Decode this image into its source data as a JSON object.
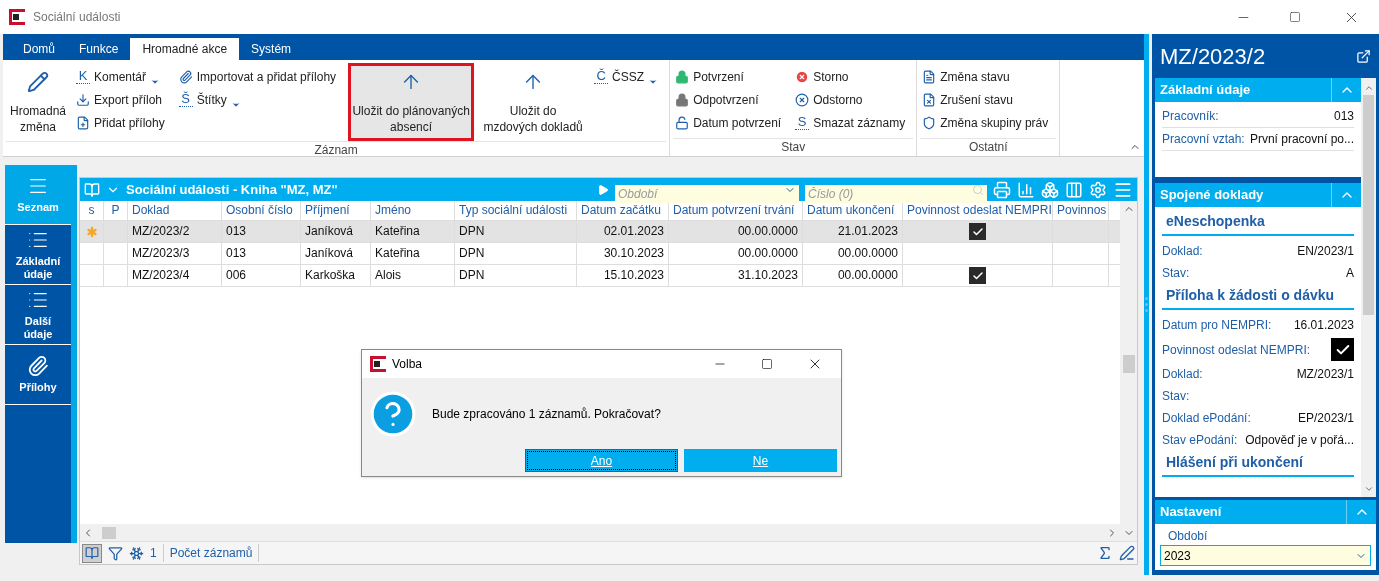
{
  "window": {
    "title": "Sociální události"
  },
  "ribbon": {
    "tabs": [
      {
        "label": "Domů",
        "selected": false
      },
      {
        "label": "Funkce",
        "selected": false
      },
      {
        "label": "Hromadné akce",
        "selected": true
      },
      {
        "label": "Systém",
        "selected": false
      }
    ],
    "groups": [
      {
        "label": "Záznam",
        "columns": [
          [
            {
              "kind": "large",
              "label": "Hromadná změna",
              "menu": false,
              "highlighted": false
            }
          ],
          [
            {
              "kind": "small",
              "key": "K",
              "label": "Komentář",
              "menu": true,
              "highlighted": false
            },
            {
              "kind": "small",
              "label": "Export příloh",
              "menu": false,
              "highlighted": false
            },
            {
              "kind": "small",
              "label": "Přidat přílohy",
              "menu": false,
              "highlighted": false
            }
          ],
          [
            {
              "kind": "small",
              "label": "Importovat a přidat přílohy",
              "menu": false,
              "highlighted": false
            },
            {
              "kind": "small",
              "key": "Š",
              "label": "Štítky",
              "menu": true,
              "highlighted": false
            }
          ],
          [
            {
              "kind": "large",
              "label": "Uložit do plánovaných absencí",
              "menu": false,
              "highlighted": true
            }
          ],
          [
            {
              "kind": "large",
              "label": "Uložit do mzdových dokladů",
              "menu": false,
              "highlighted": false
            }
          ],
          [
            {
              "kind": "small",
              "key": "Č",
              "label": "ČSSZ",
              "menu": true,
              "highlighted": false
            }
          ]
        ]
      },
      {
        "label": "Stav",
        "columns": [
          [
            {
              "kind": "small",
              "label": "Potvrzení",
              "menu": false,
              "highlighted": false
            },
            {
              "kind": "small",
              "label": "Odpotvrzení",
              "menu": false,
              "highlighted": false
            },
            {
              "kind": "small",
              "label": "Datum potvrzení",
              "menu": false,
              "highlighted": false
            }
          ],
          [
            {
              "kind": "small",
              "label": "Storno",
              "menu": false,
              "highlighted": false
            },
            {
              "kind": "small",
              "label": "Odstorno",
              "menu": false,
              "highlighted": false
            },
            {
              "kind": "small",
              "key": "S",
              "label": "Smazat záznamy",
              "menu": false,
              "highlighted": false
            }
          ]
        ]
      },
      {
        "label": "Ostatní",
        "columns": [
          [
            {
              "kind": "small",
              "label": "Změna stavu",
              "menu": false,
              "highlighted": false
            },
            {
              "kind": "small",
              "label": "Zrušení stavu",
              "menu": false,
              "highlighted": false
            },
            {
              "kind": "small",
              "label": "Změna skupiny práv",
              "menu": false,
              "highlighted": false
            }
          ]
        ]
      }
    ]
  },
  "nav": [
    {
      "label": "Seznam",
      "selected": true
    },
    {
      "label": "Základní údaje",
      "selected": false
    },
    {
      "label": "Další údaje",
      "selected": false
    },
    {
      "label": "Přílohy",
      "selected": false
    }
  ],
  "grid": {
    "title": "Sociální události - Kniha \"MZ, MZ\"",
    "period_placeholder": "Období",
    "number_placeholder": "Číslo (0)",
    "columns": [
      "s",
      "P",
      "Doklad",
      "Osobní číslo",
      "Příjmení",
      "Jméno",
      "Typ sociální události",
      "Datum začátku",
      "Datum potvrzení trvání",
      "Datum ukončení",
      "Povinnost odeslat NEMPRI",
      "Povinnos"
    ],
    "rows": [
      {
        "selected": true,
        "marked": true,
        "cells": [
          "",
          "",
          "MZ/2023/2",
          "013",
          "Janíková",
          "Kateřina",
          "DPN",
          "02.01.2023",
          "00.00.0000",
          "21.01.2023"
        ],
        "nempri": true
      },
      {
        "selected": false,
        "marked": false,
        "cells": [
          "",
          "",
          "MZ/2023/3",
          "013",
          "Janíková",
          "Kateřina",
          "DPN",
          "30.10.2023",
          "00.00.0000",
          "00.00.0000"
        ],
        "nempri": false
      },
      {
        "selected": false,
        "marked": false,
        "cells": [
          "",
          "",
          "MZ/2023/4",
          "006",
          "Karkoška",
          "Alois",
          "DPN",
          "15.10.2023",
          "31.10.2023",
          "00.00.0000"
        ],
        "nempri": true
      }
    ],
    "status": {
      "count": "1",
      "label": "Počet záznamů"
    }
  },
  "dialog": {
    "title": "Volba",
    "message": "Bude zpracováno 1 záznamů. Pokračovat?",
    "buttons": [
      {
        "label": "Ano",
        "focused": true
      },
      {
        "label": "Ne",
        "focused": false
      }
    ]
  },
  "detail": {
    "title": "MZ/2023/2",
    "sections": [
      {
        "title": "Základní údaje",
        "groups": [
          {
            "fields": [
              {
                "kind": "text",
                "label": "Pracovník:",
                "value": "013"
              },
              {
                "kind": "text",
                "label": "Pracovní vztah:",
                "value": "První pracovní po..."
              }
            ]
          }
        ]
      },
      {
        "title": "Spojené doklady",
        "groups": [
          {
            "heading": "eNeschopenka",
            "fields": [
              {
                "kind": "text",
                "label": "Doklad:",
                "value": "EN/2023/1"
              },
              {
                "kind": "text",
                "label": "Stav:",
                "value": "A"
              }
            ]
          },
          {
            "heading": "Příloha k žádosti o dávku",
            "fields": [
              {
                "kind": "text",
                "label": "Datum pro NEMPRI:",
                "value": "16.01.2023"
              },
              {
                "kind": "check",
                "label": "Povinnost odeslat NEMPRI:",
                "checked": true
              },
              {
                "kind": "text",
                "label": "Doklad:",
                "value": "MZ/2023/1"
              },
              {
                "kind": "text",
                "label": "Stav:"
              },
              {
                "kind": "text",
                "label": "Doklad ePodání:",
                "value": "EP/2023/1"
              },
              {
                "kind": "text",
                "label": "Stav ePodání:",
                "value": "Odpověď je v pořá..."
              }
            ]
          },
          {
            "heading": "Hlášení při ukončení"
          }
        ]
      }
    ],
    "settings": {
      "title": "Nastavení",
      "label": "Období",
      "value": "2023"
    }
  }
}
